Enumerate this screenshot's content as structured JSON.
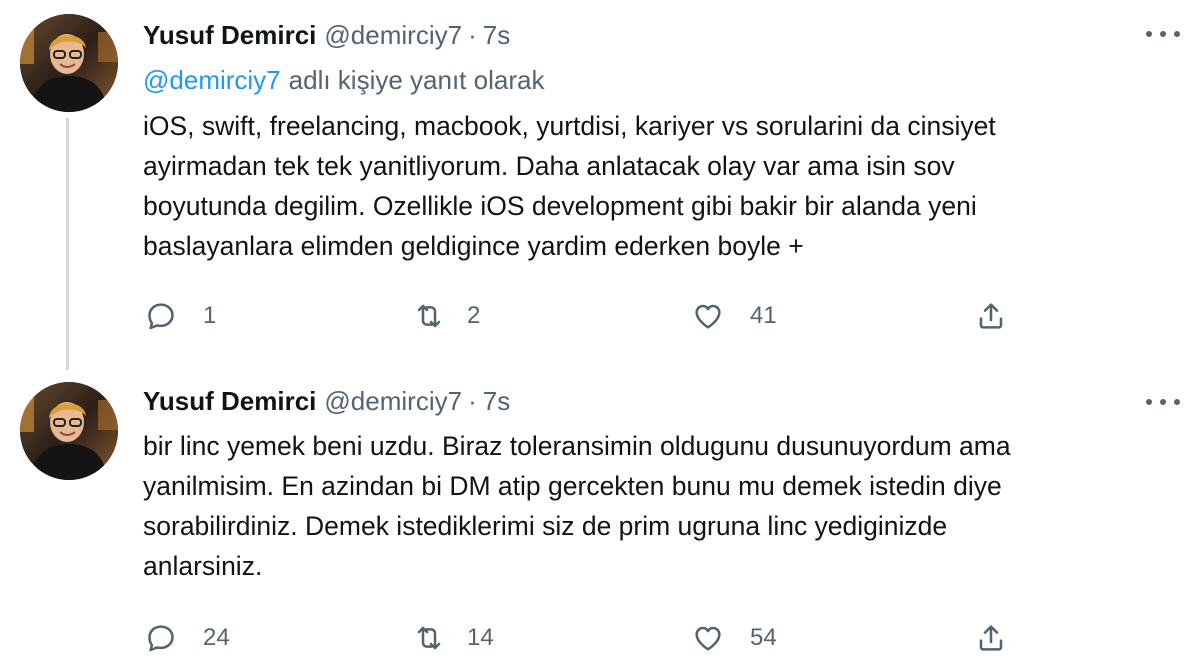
{
  "tweets": [
    {
      "author_name": "Yusuf Demirci",
      "handle": "@demirciy7",
      "separator": "·",
      "time": "7s",
      "reply_to": {
        "mention": "@demirciy7",
        "suffix": "adlı kişiye yanıt olarak"
      },
      "body_lines": [
        "iOS, swift, freelancing, macbook, yurtdisi, kariyer vs sorularini da cinsiyet",
        "ayirmadan tek tek yanitliyorum. Daha anlatacak olay var ama isin sov",
        "boyutunda degilim.  Ozellikle iOS development gibi bakir bir alanda yeni",
        "baslayanlara elimden geldigince yardim ederken boyle +"
      ],
      "replies": "1",
      "retweets": "2",
      "likes": "41"
    },
    {
      "author_name": "Yusuf Demirci",
      "handle": "@demirciy7",
      "separator": "·",
      "time": "7s",
      "body_lines": [
        "bir linc yemek beni uzdu. Biraz toleransimin oldugunu dusunuyordum ama",
        "yanilmisim. En azindan bi DM atip gercekten bunu mu demek istedin diye",
        "sorabilirdiniz. Demek istediklerimi siz de prim ugruna linc yediginizde",
        "anlarsiniz."
      ],
      "replies": "24",
      "retweets": "14",
      "likes": "54"
    }
  ],
  "colors": {
    "text": "#0f1419",
    "secondary": "#536471",
    "accent": "#1d9bf0",
    "thread_line": "#cfd9de"
  },
  "icons": [
    "more-icon",
    "reply-icon",
    "retweet-icon",
    "like-icon",
    "share-icon"
  ]
}
